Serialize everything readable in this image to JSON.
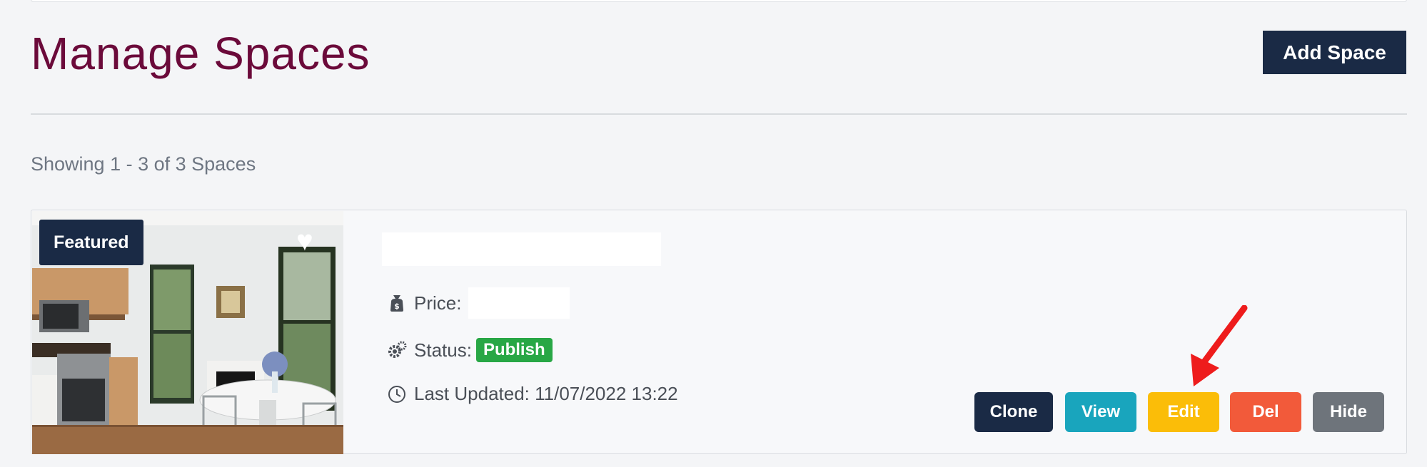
{
  "page": {
    "title": "Manage Spaces",
    "add_button": "Add Space",
    "showing_text": "Showing 1 - 3 of 3 Spaces"
  },
  "listing": {
    "badge": "Featured",
    "price_label": "Price:",
    "status_label": "Status:",
    "status_value": "Publish",
    "updated_label": "Last Updated:",
    "updated_value": "11/07/2022 13:22",
    "updated_text": "Last Updated: 11/07/2022 13:22",
    "image_description": "kitchen and dining room interior photo",
    "icons": {
      "price": "money-bag-icon",
      "status": "gears-icon",
      "updated": "clock-icon",
      "favorite": "heart-icon"
    }
  },
  "actions": {
    "clone": "Clone",
    "view": "View",
    "edit": "Edit",
    "del": "Del",
    "hide": "Hide"
  },
  "colors": {
    "title": "#6b0a3a",
    "primary_dark": "#1a2a45",
    "view": "#19a5bd",
    "edit": "#fbbd08",
    "del": "#f25a3a",
    "hide": "#6e747b",
    "publish": "#28a745",
    "annotation_arrow": "#ee1c1c"
  }
}
